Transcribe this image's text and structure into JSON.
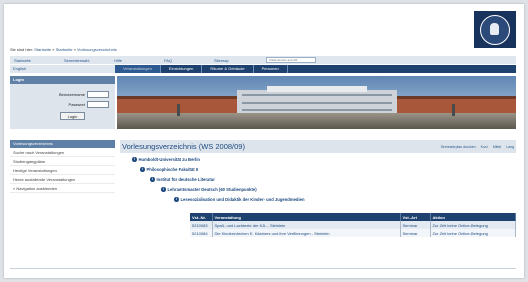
{
  "breadcrumb": {
    "prefix": "Sie sind hier:",
    "items": [
      "Startseite",
      "Startseite",
      "Vorlesungsverzeichnis"
    ],
    "separator": " » "
  },
  "topnav": {
    "items": [
      "Startseite",
      "Semesterwahl",
      "Hilfe",
      "FAQ",
      "Sitemap"
    ],
    "search_placeholder": "Volltextsuche auf HIS"
  },
  "language": {
    "label": "English"
  },
  "tabs": [
    "Veranstaltungen",
    "Einrichtungen",
    "Räume & Gebäude",
    "Personen"
  ],
  "login": {
    "header": "Login",
    "username_label": "Benutzername",
    "password_label": "Passwort",
    "button": "Login"
  },
  "sidebar": {
    "header": "Vorlesungsverzeichnis",
    "items": [
      "Suche nach Veranstaltungen",
      "Studiengangpläne",
      "Heutige Veranstaltungen",
      "Heute ausfallende Veranstaltungen",
      "» Navigation ausblenden"
    ]
  },
  "main": {
    "title": "Vorlesungsverzeichnis (WS 2008/09)",
    "tools": [
      "Semesterplan drucken",
      "Kurz",
      "Mittel",
      "Lang"
    ],
    "tree": [
      "Humboldt-Universität zu Berlin",
      "Philosophische Fakultät II",
      "Institut für deutsche Literatur",
      "Lehramtsmaster Deutsch (60 Studienpunkte)",
      "Lesesozialisation und Didaktik der Kinder- und Jugendmedien"
    ],
    "table": {
      "headers": [
        "Vst.-Nr.",
        "Veranstaltung",
        "Vst.-Art",
        "Aktion"
      ],
      "rows": [
        [
          "5210083",
          "Spaß- und Lachtexte der KJL  -  Steinlein",
          "Seminar",
          "Zur Zeit keine Online-Belegung"
        ],
        [
          "5210084",
          "Die Kindermärchen E. Kästners und ihre Verfilmungen  -  Steinlein",
          "Seminar",
          "Zur Zeit keine Online-Belegung"
        ]
      ]
    }
  },
  "colors": {
    "nav_dark": "#1e4270",
    "header_blue": "#5e7fa6",
    "light_panel": "#dde4ec",
    "link": "#1e4a80"
  },
  "icons": {
    "logo": "university-seal-icon",
    "tree_node": "info-circle-icon"
  }
}
